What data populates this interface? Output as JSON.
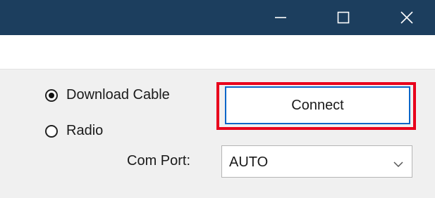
{
  "window": {
    "titlebar_color": "#1c3e5e",
    "controls": [
      "minimize-icon",
      "maximize-icon",
      "close-icon"
    ]
  },
  "connection": {
    "options": [
      {
        "label": "Download Cable",
        "selected": true
      },
      {
        "label": "Radio",
        "selected": false
      }
    ],
    "connect_label": "Connect",
    "highlight_color": "#e8001c",
    "com_port_label": "Com Port:",
    "com_port_value": "AUTO"
  }
}
